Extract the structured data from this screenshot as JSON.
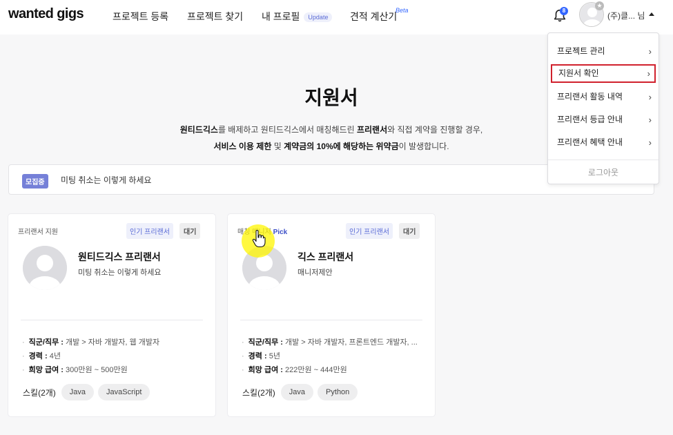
{
  "header": {
    "logo": "wanted gigs",
    "nav": [
      {
        "label": "프로젝트 등록"
      },
      {
        "label": "프로젝트 찾기"
      },
      {
        "label": "내 프로필",
        "badge": "Update"
      },
      {
        "label": "견적 계산기",
        "badge": "Beta"
      }
    ],
    "notification_count": "8",
    "user_name": "(주)클... 님"
  },
  "page": {
    "title": "지원서",
    "notice_line1_parts": [
      "원티드긱스",
      "를 배제하고 원티드긱스에서 매칭해드린 ",
      "프리랜서",
      "와 직접 계약을 진행할 경우,"
    ],
    "notice_line2_parts": [
      "서비스 이용 제한",
      " 및 ",
      "계약금의 10%에 해당하는 위약금",
      "이 발생합니다."
    ]
  },
  "recruit_bar": {
    "tag": "모집중",
    "text": "미팅 취소는 이렇게 하세요"
  },
  "cards": [
    {
      "type": "프리랜서 지원",
      "popular_tag": "인기 프리랜서",
      "status_tag": "대기",
      "name": "원티드긱스 프리랜서",
      "desc": "미팅 취소는 이렇게 하세요",
      "job_label": "직군/직무 :",
      "job_value": "개발 > 자바 개발자, 웹 개발자",
      "career_label": "경력 :",
      "career_value": "4년",
      "salary_label": "희망 급여 :",
      "salary_value": "300만원 ~ 500만원",
      "skills_label": "스킬(2개)",
      "skills": [
        "Java",
        "JavaScript"
      ]
    },
    {
      "type": "매칭 매니저 ",
      "type_pick": "Pick",
      "popular_tag": "인기 프리랜서",
      "status_tag": "대기",
      "name": "긱스 프리랜서",
      "desc": "매니저제안",
      "job_label": "직군/직무 :",
      "job_value": "개발 > 자바 개발자, 프론트엔드 개발자, ...",
      "career_label": "경력 :",
      "career_value": "5년",
      "salary_label": "희망 급여 :",
      "salary_value": "222만원 ~ 444만원",
      "skills_label": "스킬(2개)",
      "skills": [
        "Java",
        "Python"
      ]
    }
  ],
  "dropdown": {
    "items": [
      "프로젝트 관리",
      "지원서 확인",
      "프리랜서 활동 내역",
      "프리랜서 등급 안내",
      "프리랜서 혜택 안내"
    ],
    "active_index": 1,
    "logout": "로그아웃"
  },
  "colors": {
    "accent": "#3366ff",
    "recruit_tag_bg": "#7580d8",
    "highlight_border": "#d0202c"
  }
}
